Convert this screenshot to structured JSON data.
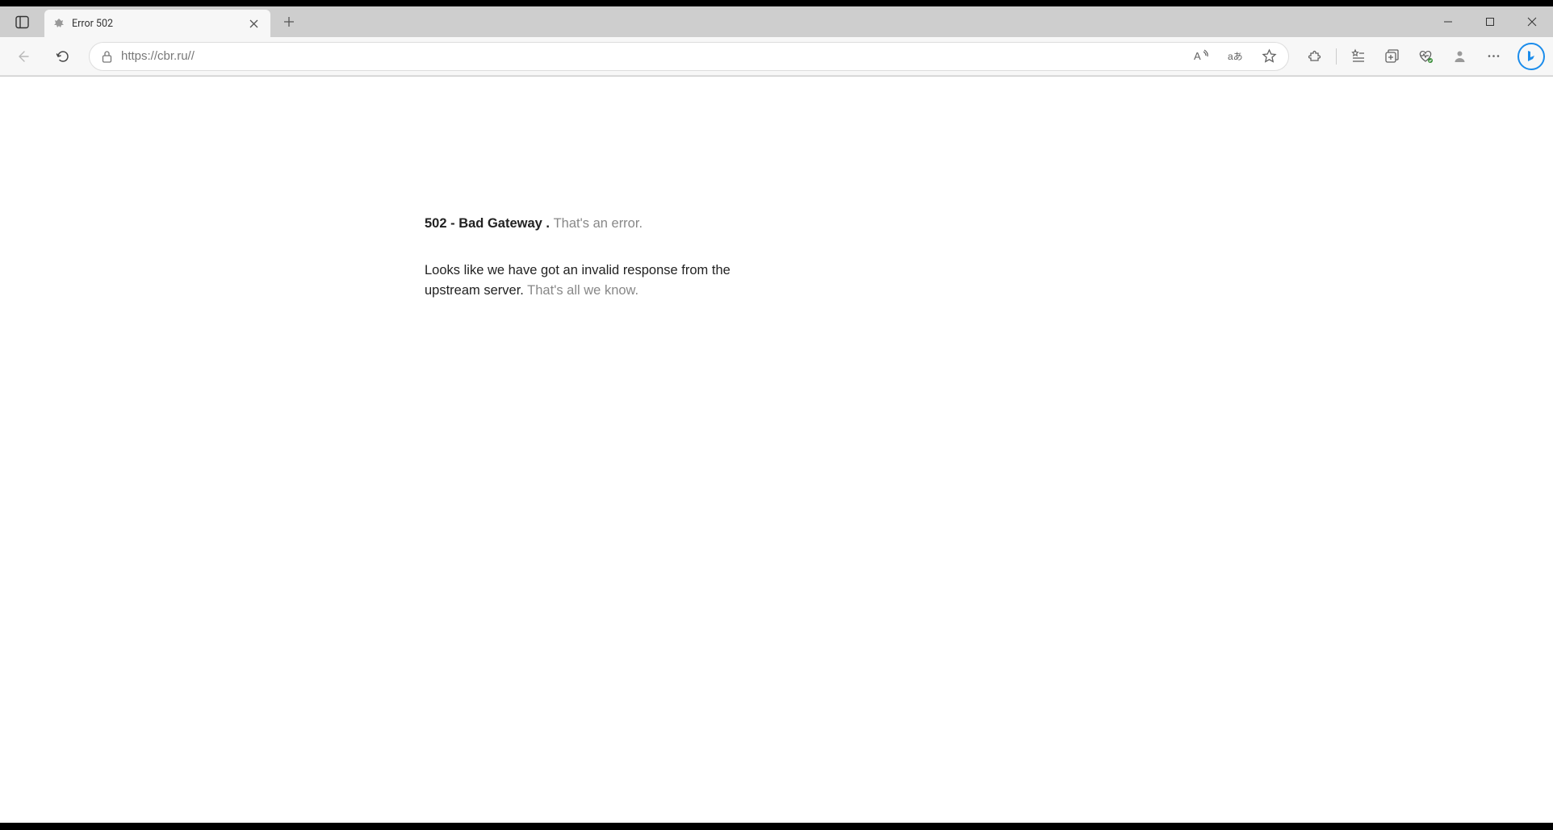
{
  "tab": {
    "title": "Error 502"
  },
  "address": {
    "url": "https://cbr.ru//"
  },
  "page": {
    "error_code": "502 - Bad Gateway . ",
    "error_label": "That's an error.",
    "body_main": "Looks like we have got an invalid response from the upstream server. ",
    "body_tail": "That's all we know."
  }
}
